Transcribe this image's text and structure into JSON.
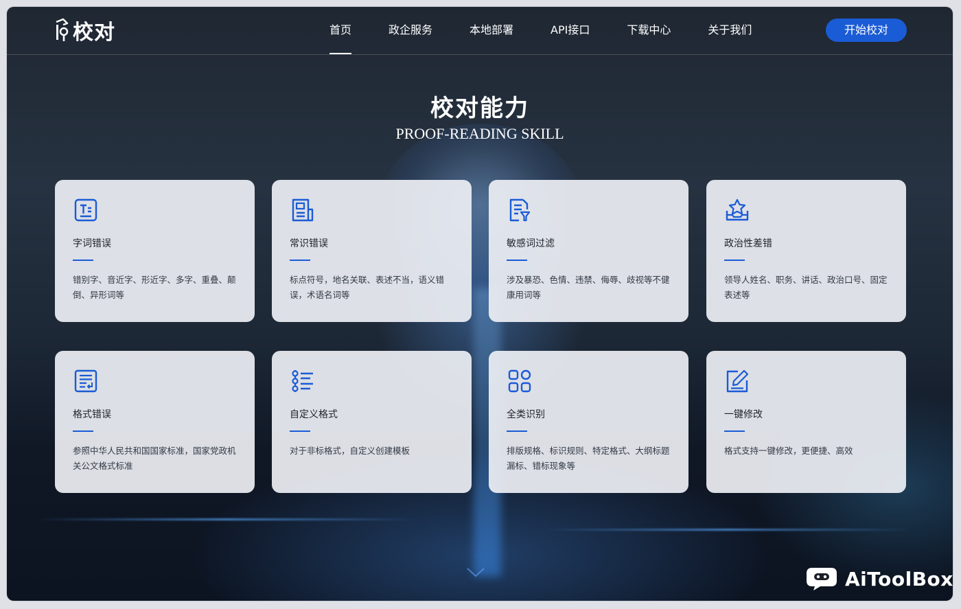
{
  "brand": {
    "name": "校对"
  },
  "nav": {
    "items": [
      {
        "label": "首页"
      },
      {
        "label": "政企服务"
      },
      {
        "label": "本地部署"
      },
      {
        "label": "API接口"
      },
      {
        "label": "下载中心"
      },
      {
        "label": "关于我们"
      }
    ],
    "active_index": 0,
    "cta_label": "开始校对"
  },
  "section": {
    "title": "校对能力",
    "subtitle": "PROOF-READING SKILL"
  },
  "cards": [
    {
      "title": "字词错误",
      "desc": "错别字、音近字、形近字、多字、重叠、颠倒、异形词等",
      "icon": "text-box-icon"
    },
    {
      "title": "常识错误",
      "desc": "标点符号，地名关联、表述不当，语义错误，术语名词等",
      "icon": "document-icon"
    },
    {
      "title": "敏感词过滤",
      "desc": "涉及暴恐、色情、违禁、侮辱、歧视等不健康用词等",
      "icon": "document-filter-icon"
    },
    {
      "title": "政治性差错",
      "desc": "领导人姓名、职务、讲话、政治口号、固定表述等",
      "icon": "star-tray-icon"
    },
    {
      "title": "格式错误",
      "desc": "参照中华人民共和国国家标准，国家党政机关公文格式标准",
      "icon": "format-list-icon"
    },
    {
      "title": "自定义格式",
      "desc": "对于非标格式，自定义创建模板",
      "icon": "custom-list-icon"
    },
    {
      "title": "全类识别",
      "desc": "排版规格、标识规则、特定格式、大纲标题漏标、错标现象等",
      "icon": "grid-icon"
    },
    {
      "title": "一键修改",
      "desc": "格式支持一键修改，更便捷、高效",
      "icon": "edit-icon"
    }
  ],
  "watermark": {
    "text": "AiToolBox"
  },
  "colors": {
    "accent": "#1a5bd6",
    "card_bg": "#eceef3"
  }
}
